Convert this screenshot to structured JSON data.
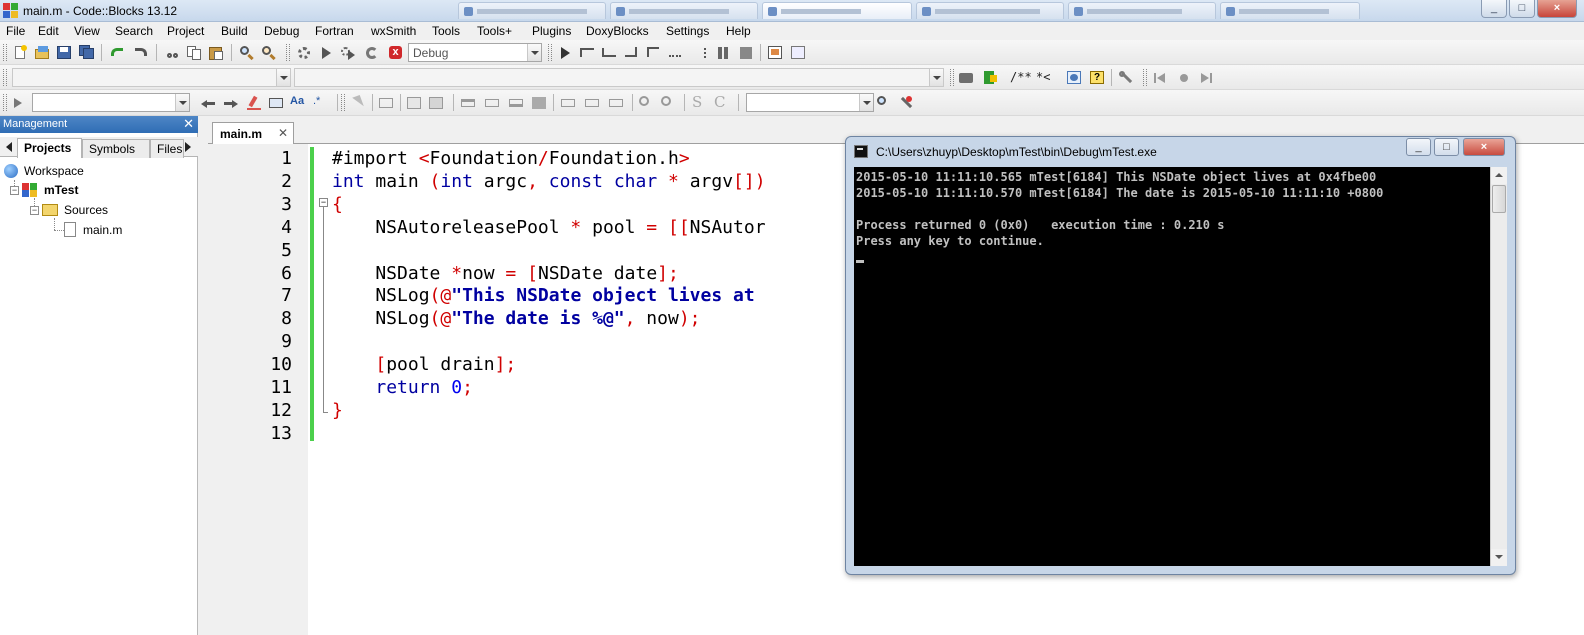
{
  "window": {
    "title": "main.m - Code::Blocks 13.12"
  },
  "menu": {
    "items": [
      "File",
      "Edit",
      "View",
      "Search",
      "Project",
      "Build",
      "Debug",
      "Fortran",
      "wxSmith",
      "Tools",
      "Tools+",
      "Plugins",
      "DoxyBlocks",
      "Settings",
      "Help"
    ]
  },
  "toolbar": {
    "build_target": "Debug",
    "doxy_block_comment": "/**",
    "doxy_line_comment": "*<"
  },
  "management": {
    "title": "Management",
    "tabs": [
      "Projects",
      "Symbols",
      "Files"
    ],
    "active_tab": "Projects",
    "tree": {
      "workspace": "Workspace",
      "project": "mTest",
      "folder": "Sources",
      "file": "main.m"
    }
  },
  "editor": {
    "tab_label": "main.m",
    "lines": [
      {
        "n": "1",
        "parts": [
          [
            "pp",
            "#import "
          ],
          [
            "op",
            "<"
          ],
          [
            "pp",
            "Foundation"
          ],
          [
            "op",
            "/"
          ],
          [
            "pp",
            "Foundation.h"
          ],
          [
            "op",
            ">"
          ]
        ]
      },
      {
        "n": "2",
        "parts": [
          [
            "kw",
            "int"
          ],
          [
            "pp",
            " main "
          ],
          [
            "op",
            "("
          ],
          [
            "kw",
            "int"
          ],
          [
            "pp",
            " argc"
          ],
          [
            "op",
            ","
          ],
          [
            "pp",
            " "
          ],
          [
            "kw",
            "const"
          ],
          [
            "pp",
            " "
          ],
          [
            "kw",
            "char"
          ],
          [
            "pp",
            " "
          ],
          [
            "op",
            "*"
          ],
          [
            "pp",
            " argv"
          ],
          [
            "op",
            "[])"
          ]
        ]
      },
      {
        "n": "3",
        "parts": [
          [
            "op",
            "{"
          ]
        ]
      },
      {
        "n": "4",
        "parts": [
          [
            "pp",
            "    NSAutoreleasePool "
          ],
          [
            "op",
            "*"
          ],
          [
            "pp",
            " pool "
          ],
          [
            "op",
            "="
          ],
          [
            "pp",
            " "
          ],
          [
            "op",
            "[["
          ],
          [
            "pp",
            "NSAutor"
          ]
        ]
      },
      {
        "n": "5",
        "parts": []
      },
      {
        "n": "6",
        "parts": [
          [
            "pp",
            "    NSDate "
          ],
          [
            "op",
            "*"
          ],
          [
            "pp",
            "now "
          ],
          [
            "op",
            "="
          ],
          [
            "pp",
            " "
          ],
          [
            "op",
            "["
          ],
          [
            "pp",
            "NSDate date"
          ],
          [
            "op",
            "];"
          ]
        ]
      },
      {
        "n": "7",
        "parts": [
          [
            "pp",
            "    NSLog"
          ],
          [
            "op",
            "(@"
          ],
          [
            "str",
            "\"This NSDate object lives at"
          ]
        ]
      },
      {
        "n": "8",
        "parts": [
          [
            "pp",
            "    NSLog"
          ],
          [
            "op",
            "(@"
          ],
          [
            "str",
            "\"The date is %@\""
          ],
          [
            "op",
            ","
          ],
          [
            "pp",
            " now"
          ],
          [
            "op",
            ");"
          ]
        ]
      },
      {
        "n": "9",
        "parts": []
      },
      {
        "n": "10",
        "parts": [
          [
            "pp",
            "    "
          ],
          [
            "op",
            "["
          ],
          [
            "pp",
            "pool drain"
          ],
          [
            "op",
            "];"
          ]
        ]
      },
      {
        "n": "11",
        "parts": [
          [
            "pp",
            "    "
          ],
          [
            "kw",
            "return"
          ],
          [
            "pp",
            " "
          ],
          [
            "num",
            "0"
          ],
          [
            "op",
            ";"
          ]
        ]
      },
      {
        "n": "12",
        "parts": [
          [
            "op",
            "}"
          ]
        ]
      },
      {
        "n": "13",
        "parts": []
      }
    ]
  },
  "console": {
    "title": "C:\\Users\\zhuyp\\Desktop\\mTest\\bin\\Debug\\mTest.exe",
    "lines": [
      "2015-05-10 11:11:10.565 mTest[6184] This NSDate object lives at 0x4fbe00",
      "2015-05-10 11:11:10.570 mTest[6184] The date is 2015-05-10 11:11:10 +0800",
      "",
      "Process returned 0 (0x0)   execution time : 0.210 s",
      "Press any key to continue."
    ]
  },
  "colors": {
    "keyword": "#0000a0",
    "operator": "#d00000",
    "string": "#0000a0",
    "number": "#0000f0",
    "change_bar": "#4cd04c",
    "panel_header": "#2f6db5"
  }
}
